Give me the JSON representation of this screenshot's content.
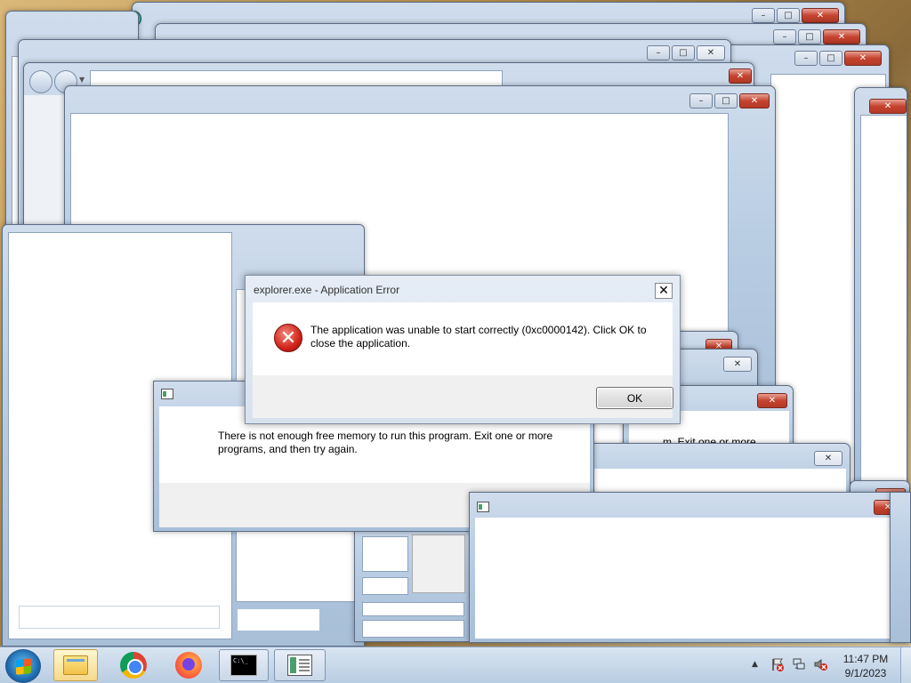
{
  "error_dialog": {
    "title": "explorer.exe - Application Error",
    "close_glyph": "✕",
    "message": "The application was unable to start correctly (0xc0000142). Click OK to close the application.",
    "icon": "error-x-icon",
    "icon_glyph": "✕",
    "ok_label": "OK"
  },
  "memory_dialog": {
    "message": "There is not enough free memory to run this program. Exit one or more programs, and then try again.",
    "partial_message": "m. Exit one or more"
  },
  "window_controls": {
    "minimize": "–",
    "maximize": "□",
    "close": "✕"
  },
  "taskbar": {
    "start": "start-orb",
    "apps": [
      {
        "name": "file-explorer",
        "state": "active"
      },
      {
        "name": "chrome"
      },
      {
        "name": "firefox"
      },
      {
        "name": "cmd",
        "text": "C:\\_"
      },
      {
        "name": "app",
        "state": "pinned"
      }
    ],
    "tray": {
      "arrow": "▲"
    },
    "clock": {
      "time": "11:47 PM",
      "date": "9/1/2023"
    }
  },
  "colors": {
    "close_red": "#c4432f",
    "title_blue": "#b9cde3",
    "error_red": "#d2231a"
  }
}
